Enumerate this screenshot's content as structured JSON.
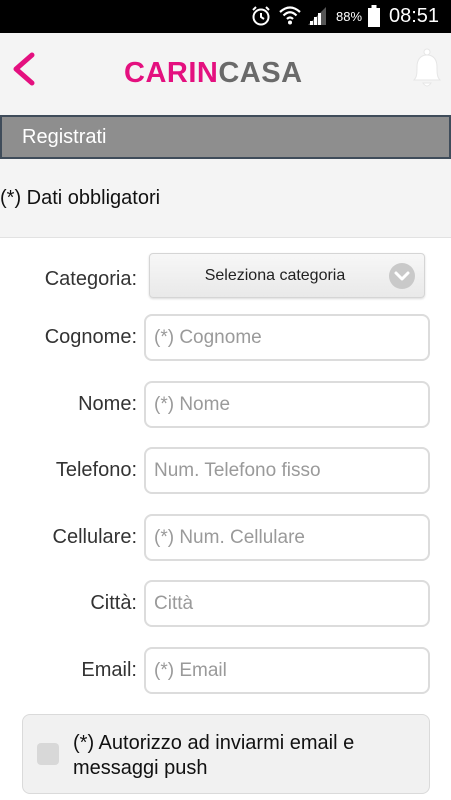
{
  "status_bar": {
    "battery_percent": "88%",
    "time": "08:51",
    "icons": [
      "alarm-icon",
      "wifi-icon",
      "signal-icon",
      "battery-icon"
    ]
  },
  "header": {
    "brand_part1": "CARIN",
    "brand_part2": "CASA",
    "back_icon": "chevron-left-icon",
    "notification_icon": "bell-icon"
  },
  "section": {
    "title": "Registrati"
  },
  "form": {
    "required_note": "(*) Dati obbligatori",
    "category": {
      "label": "Categoria:",
      "selected": "Seleziona categoria"
    },
    "surname": {
      "label": "Cognome:",
      "placeholder": "(*) Cognome",
      "value": ""
    },
    "name": {
      "label": "Nome:",
      "placeholder": "(*) Nome",
      "value": ""
    },
    "phone": {
      "label": "Telefono:",
      "placeholder": "Num. Telefono fisso",
      "value": ""
    },
    "mobile": {
      "label": "Cellulare:",
      "placeholder": "(*) Num. Cellulare",
      "value": ""
    },
    "city": {
      "label": "Città:",
      "placeholder": "Città",
      "value": ""
    },
    "email": {
      "label": "Email:",
      "placeholder": "(*) Email",
      "value": ""
    },
    "consent": {
      "text": "(*) Autorizzo ad inviarmi email e messaggi push",
      "checked": false
    }
  },
  "colors": {
    "brand_pink": "#e4107f",
    "brand_gray": "#6a6a6a",
    "section_bar": "#8e8e8e"
  }
}
